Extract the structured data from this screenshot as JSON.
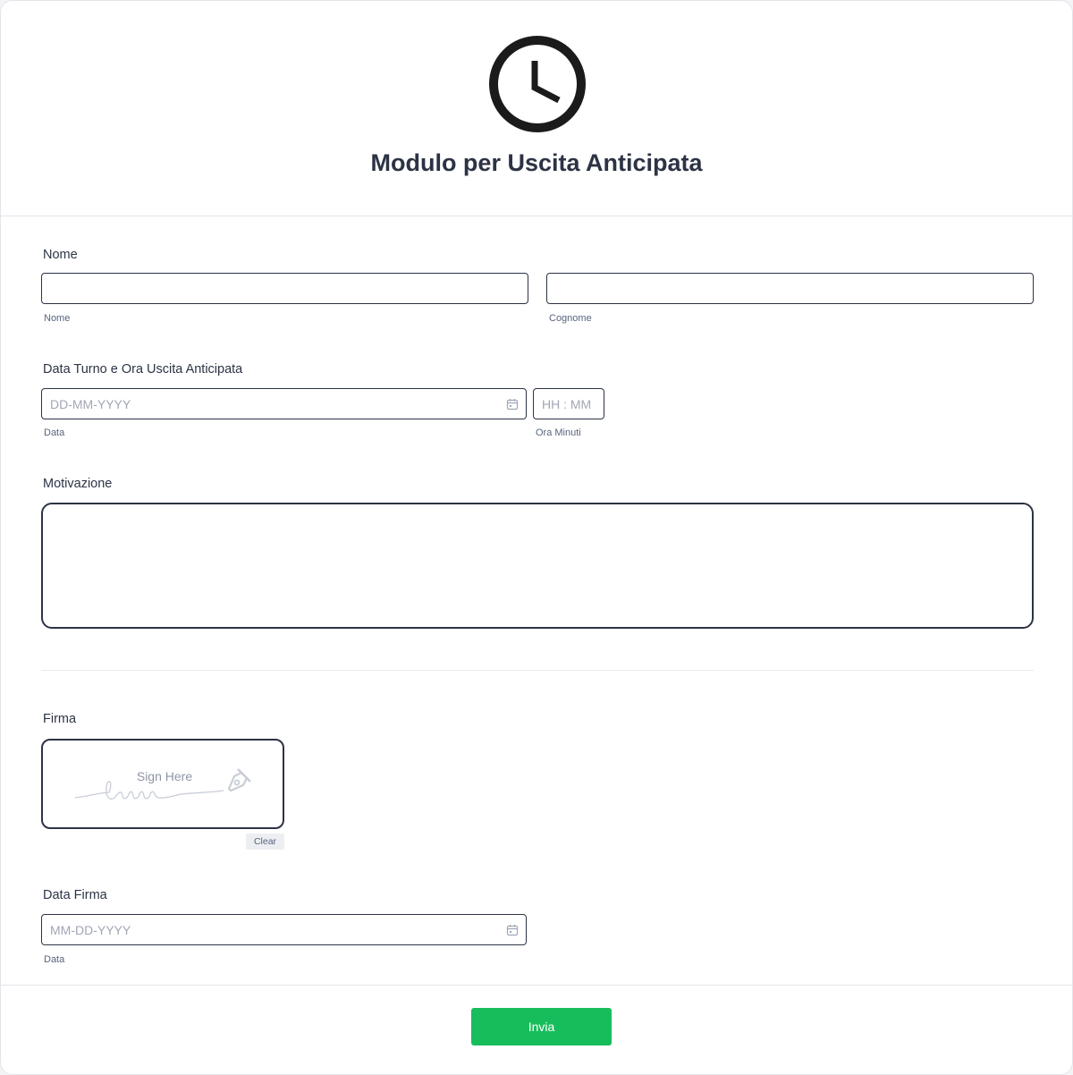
{
  "form": {
    "title": "Modulo per Uscita Anticipata",
    "header_icon": "clock-icon"
  },
  "fields": {
    "nome": {
      "label": "Nome",
      "first": {
        "value": "",
        "sublabel": "Nome"
      },
      "last": {
        "value": "",
        "sublabel": "Cognome"
      }
    },
    "shift": {
      "label": "Data Turno e Ora Uscita Anticipata",
      "date": {
        "value": "",
        "placeholder": "DD-MM-YYYY",
        "sublabel": "Data",
        "icon": "calendar-icon"
      },
      "time": {
        "value": "",
        "placeholder": "HH : MM",
        "sublabel": "Ora Minuti"
      }
    },
    "motivazione": {
      "label": "Motivazione",
      "value": ""
    },
    "firma": {
      "label": "Firma",
      "placeholder": "Sign Here",
      "clear_label": "Clear",
      "icon": "pen-nib-icon"
    },
    "data_firma": {
      "label": "Data Firma",
      "value": "",
      "placeholder": "MM-DD-YYYY",
      "sublabel": "Data",
      "icon": "calendar-icon"
    }
  },
  "footer": {
    "submit_label": "Invia"
  },
  "colors": {
    "accent": "#18bd5b",
    "text": "#2c3345",
    "border": "#2c3345",
    "placeholder": "#a0a6b4"
  }
}
